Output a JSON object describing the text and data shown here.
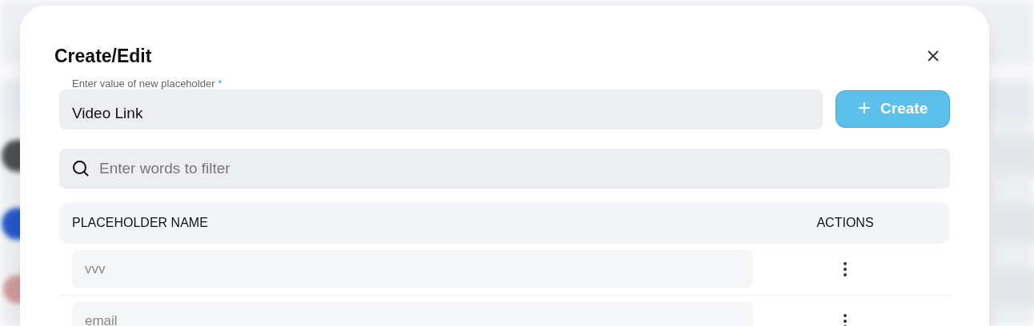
{
  "dialog": {
    "title": "Create/Edit"
  },
  "new_value_field": {
    "label": "Enter value of new placeholder",
    "required_mark": "*",
    "value": "Video Link"
  },
  "create_button": {
    "icon_text": "+",
    "label": "Create"
  },
  "filter_field": {
    "placeholder": "Enter words to filter"
  },
  "table": {
    "columns": [
      "PLACEHOLDER NAME",
      "ACTIONS"
    ],
    "rows": [
      {
        "name": "vvv"
      },
      {
        "name": "email"
      }
    ]
  }
}
